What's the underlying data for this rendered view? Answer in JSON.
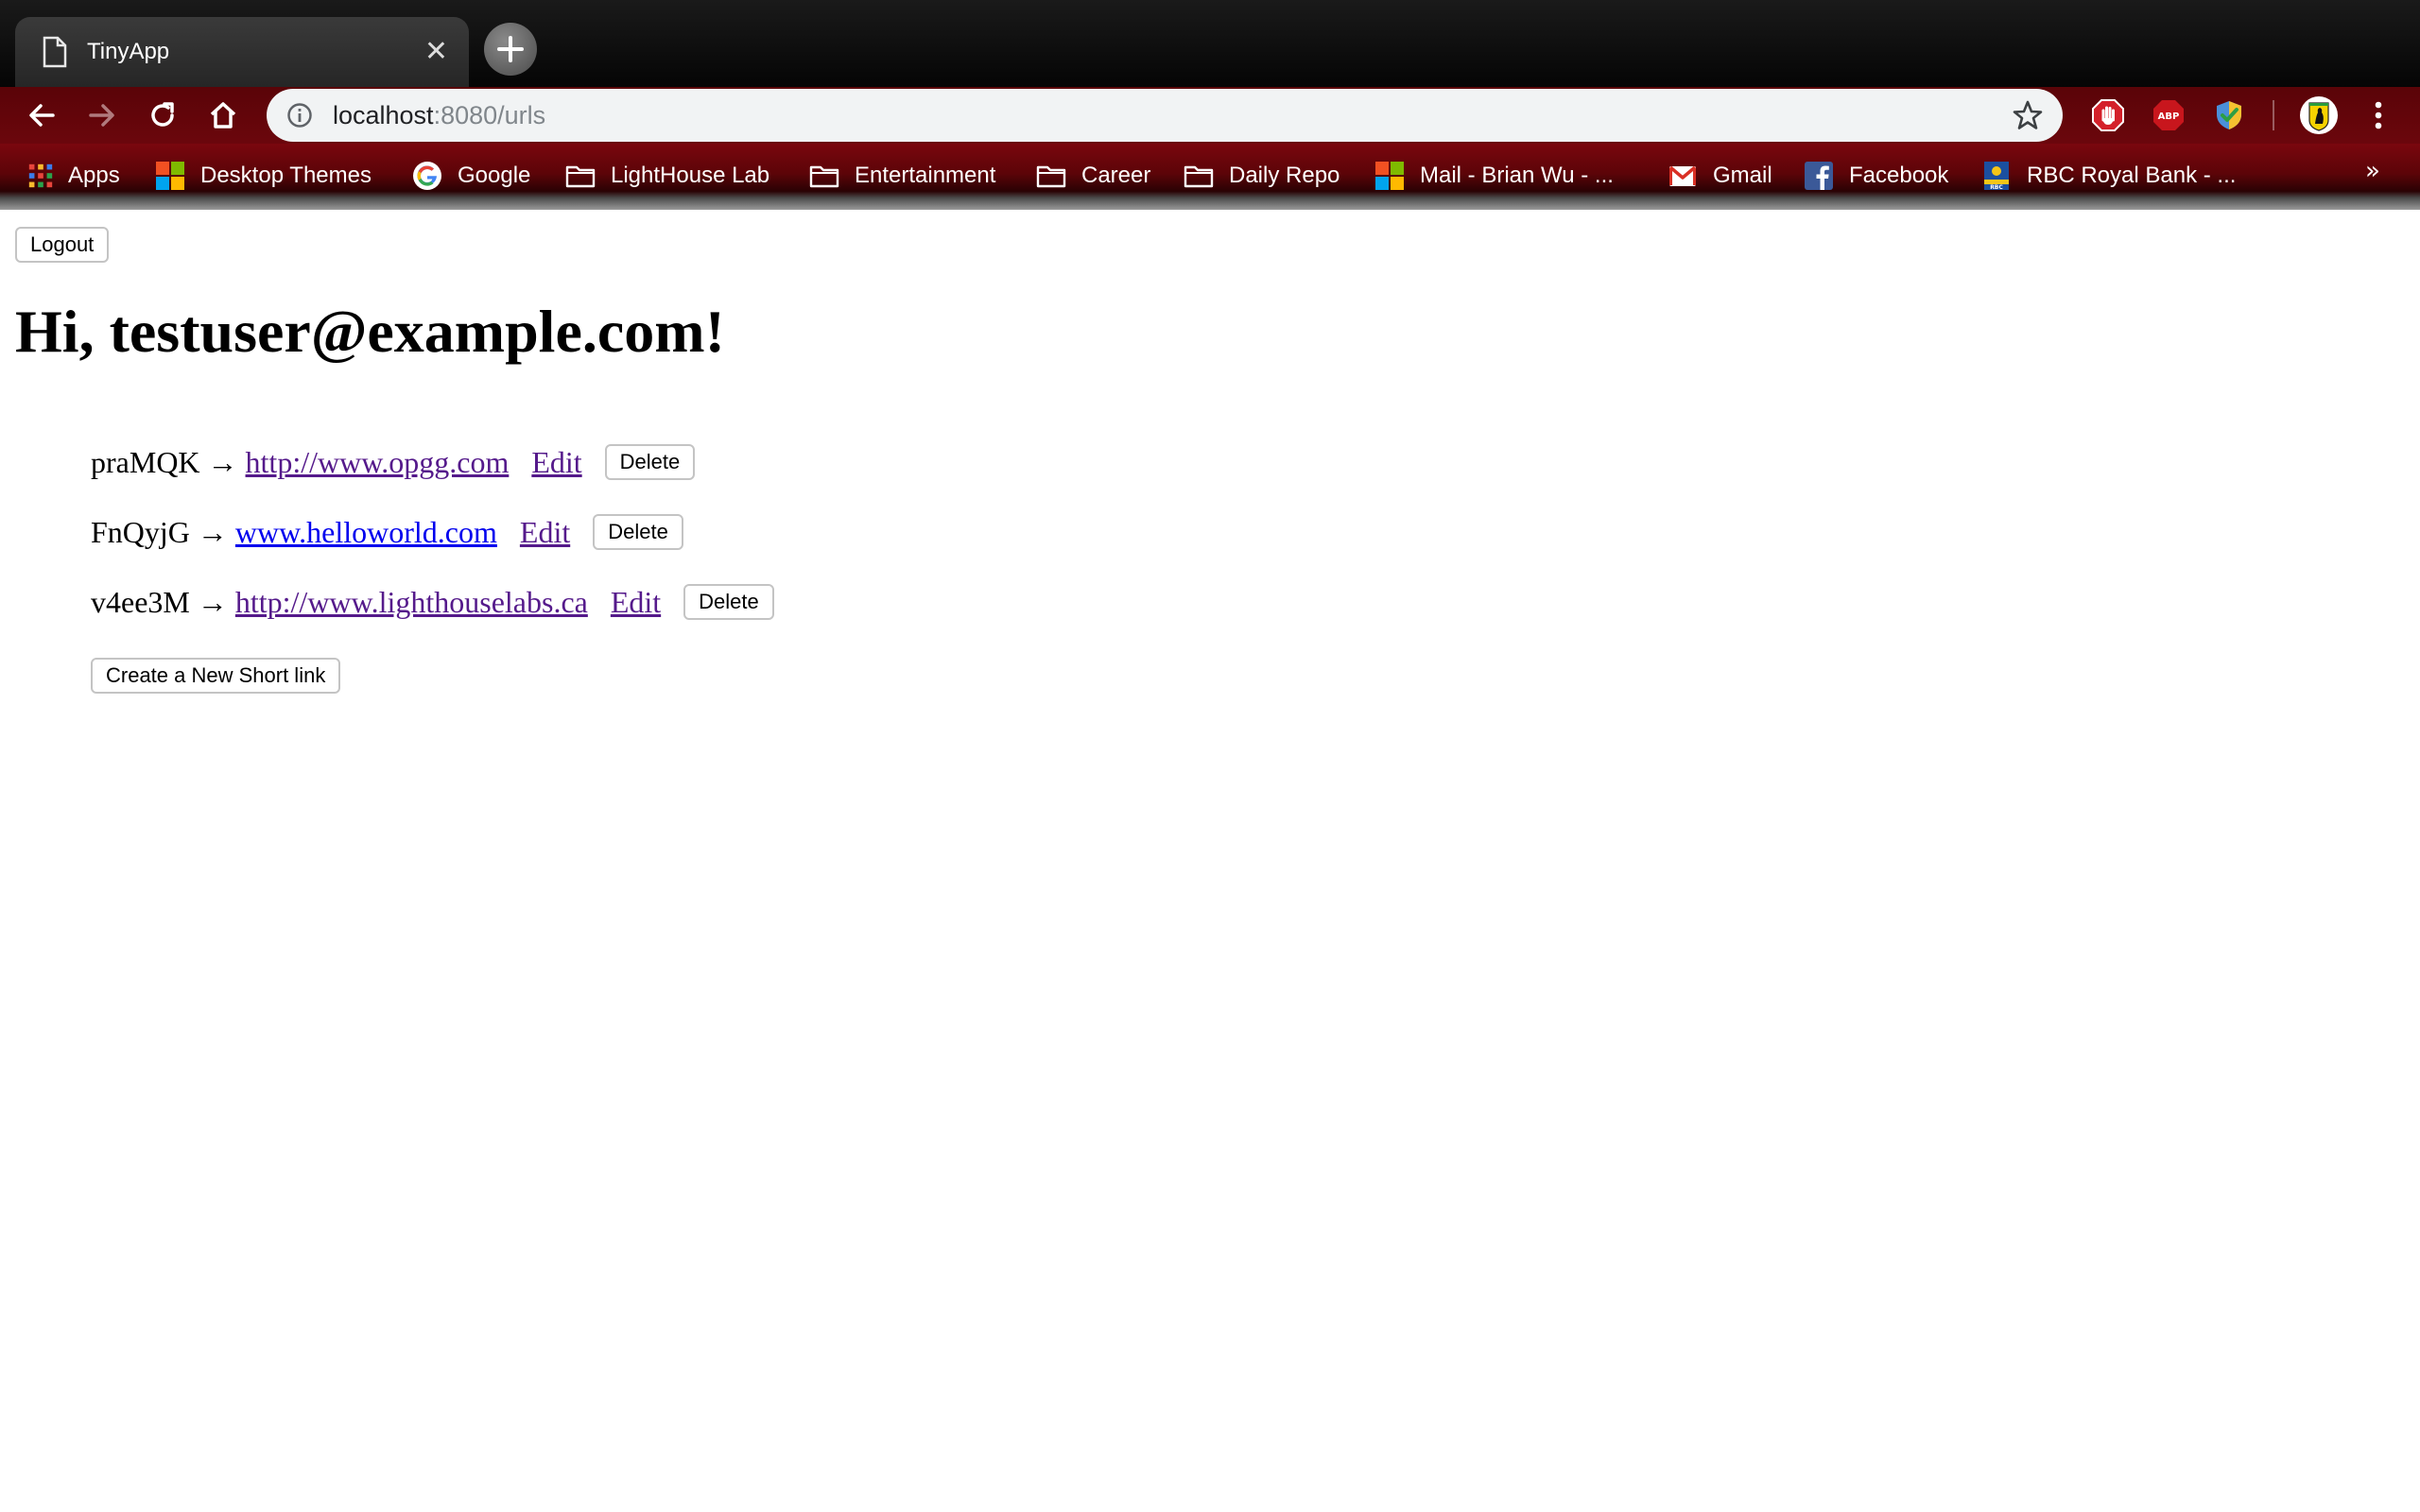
{
  "browser": {
    "tab_title": "TinyApp",
    "url_host": "localhost",
    "url_path": ":8080/urls",
    "bookmarks": [
      {
        "label": "Apps",
        "icon": "apps-grid-icon"
      },
      {
        "label": "Desktop Themes",
        "icon": "microsoft-logo-icon"
      },
      {
        "label": "Google",
        "icon": "google-logo-icon"
      },
      {
        "label": "LightHouse Lab",
        "icon": "folder-icon"
      },
      {
        "label": "Entertainment",
        "icon": "folder-icon"
      },
      {
        "label": "Career",
        "icon": "folder-icon"
      },
      {
        "label": "Daily Repo",
        "icon": "folder-icon"
      },
      {
        "label": "Mail - Brian Wu - ...",
        "icon": "microsoft-logo-icon"
      },
      {
        "label": "Gmail",
        "icon": "gmail-icon"
      },
      {
        "label": "Facebook",
        "icon": "facebook-icon"
      },
      {
        "label": "RBC Royal Bank - ...",
        "icon": "rbc-icon"
      }
    ],
    "more_bookmarks": "»",
    "extensions": [
      "stop-hand-icon",
      "adblock-plus-icon",
      "shield-check-icon"
    ],
    "colors": {
      "toolbar": "#6b060c",
      "omnibox": "#f1f3f4"
    }
  },
  "page": {
    "logout_label": "Logout",
    "greeting": "Hi, testuser@example.com!",
    "urls": [
      {
        "short": "praMQK",
        "long": "http://www.opgg.com",
        "edit": "Edit",
        "delete": "Delete"
      },
      {
        "short": "FnQyjG",
        "long": "www.helloworld.com",
        "edit": "Edit",
        "delete": "Delete"
      },
      {
        "short": "v4ee3M",
        "long": "http://www.lighthouselabs.ca",
        "edit": "Edit",
        "delete": "Delete"
      }
    ],
    "arrow": "→",
    "create_label": "Create a New Short link"
  }
}
